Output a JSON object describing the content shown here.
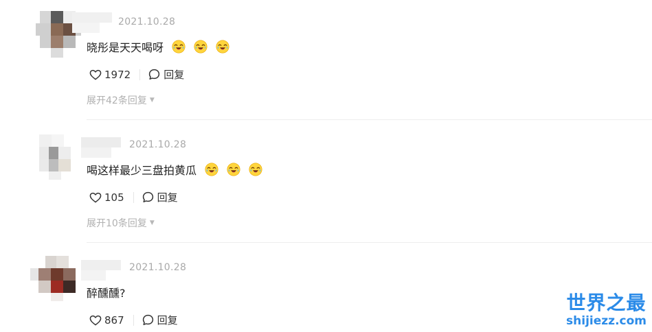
{
  "comments": [
    {
      "date": "2021.10.28",
      "text": "晓彤是天天喝呀",
      "emojis": [
        "crying-laughing-emoji",
        "crying-laughing-emoji",
        "crying-laughing-emoji"
      ],
      "likes": "1972",
      "reply_label": "回复",
      "expand_label": "展开42条回复"
    },
    {
      "date": "2021.10.28",
      "text": "喝这样最少三盘拍黄瓜",
      "emojis": [
        "crying-laughing-emoji",
        "crying-laughing-emoji",
        "crying-laughing-emoji"
      ],
      "likes": "105",
      "reply_label": "回复",
      "expand_label": "展开10条回复"
    },
    {
      "date": "2021.10.28",
      "text": "醉醺醺?",
      "emojis": [],
      "likes": "867",
      "reply_label": "回复"
    }
  ],
  "watermark": {
    "cn": "世界之最",
    "en": "shijiezz.com"
  },
  "colors": {
    "date": "#a9a9a9",
    "muted": "#b0b0b0",
    "watermark": "#2b8be8",
    "divider": "#ededed"
  }
}
